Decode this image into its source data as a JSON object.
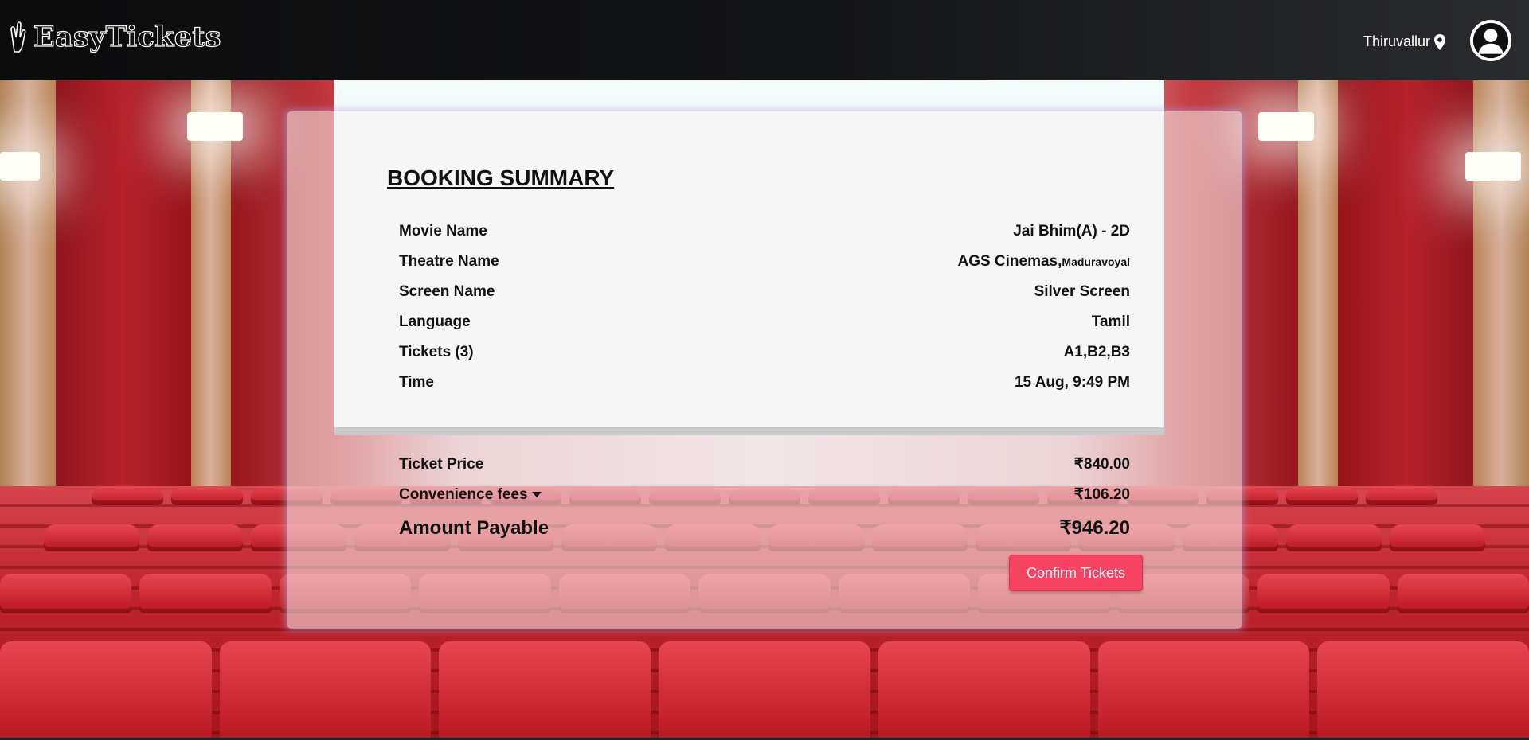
{
  "brand": {
    "name": "EasyTickets",
    "icon": "hand-peace-icon"
  },
  "header": {
    "location": "Thiruvallur",
    "location_icon": "map-pin-icon",
    "avatar_icon": "user-avatar-icon"
  },
  "summary": {
    "title": "BOOKING SUMMARY",
    "details": [
      {
        "label": "Movie Name",
        "value": "Jai Bhim(A) - 2D",
        "sub": ""
      },
      {
        "label": "Theatre Name",
        "value": "AGS Cinemas,",
        "sub": "Maduravoyal"
      },
      {
        "label": "Screen Name",
        "value": "Silver Screen",
        "sub": ""
      },
      {
        "label": "Language",
        "value": "Tamil",
        "sub": ""
      },
      {
        "label": "Tickets (3)",
        "value": "A1,B2,B3",
        "sub": ""
      },
      {
        "label": "Time",
        "value": "15 Aug, 9:49 PM",
        "sub": ""
      }
    ],
    "ticket_price": {
      "label": "Ticket Price",
      "value": "₹840.00"
    },
    "fees": {
      "label": "Convenience fees",
      "value": "₹106.20"
    },
    "payable": {
      "label": "Amount Payable",
      "value": "₹946.20"
    },
    "confirm_label": "Confirm Tickets"
  },
  "colors": {
    "accent": "#f84464",
    "navbar": "#151618"
  }
}
